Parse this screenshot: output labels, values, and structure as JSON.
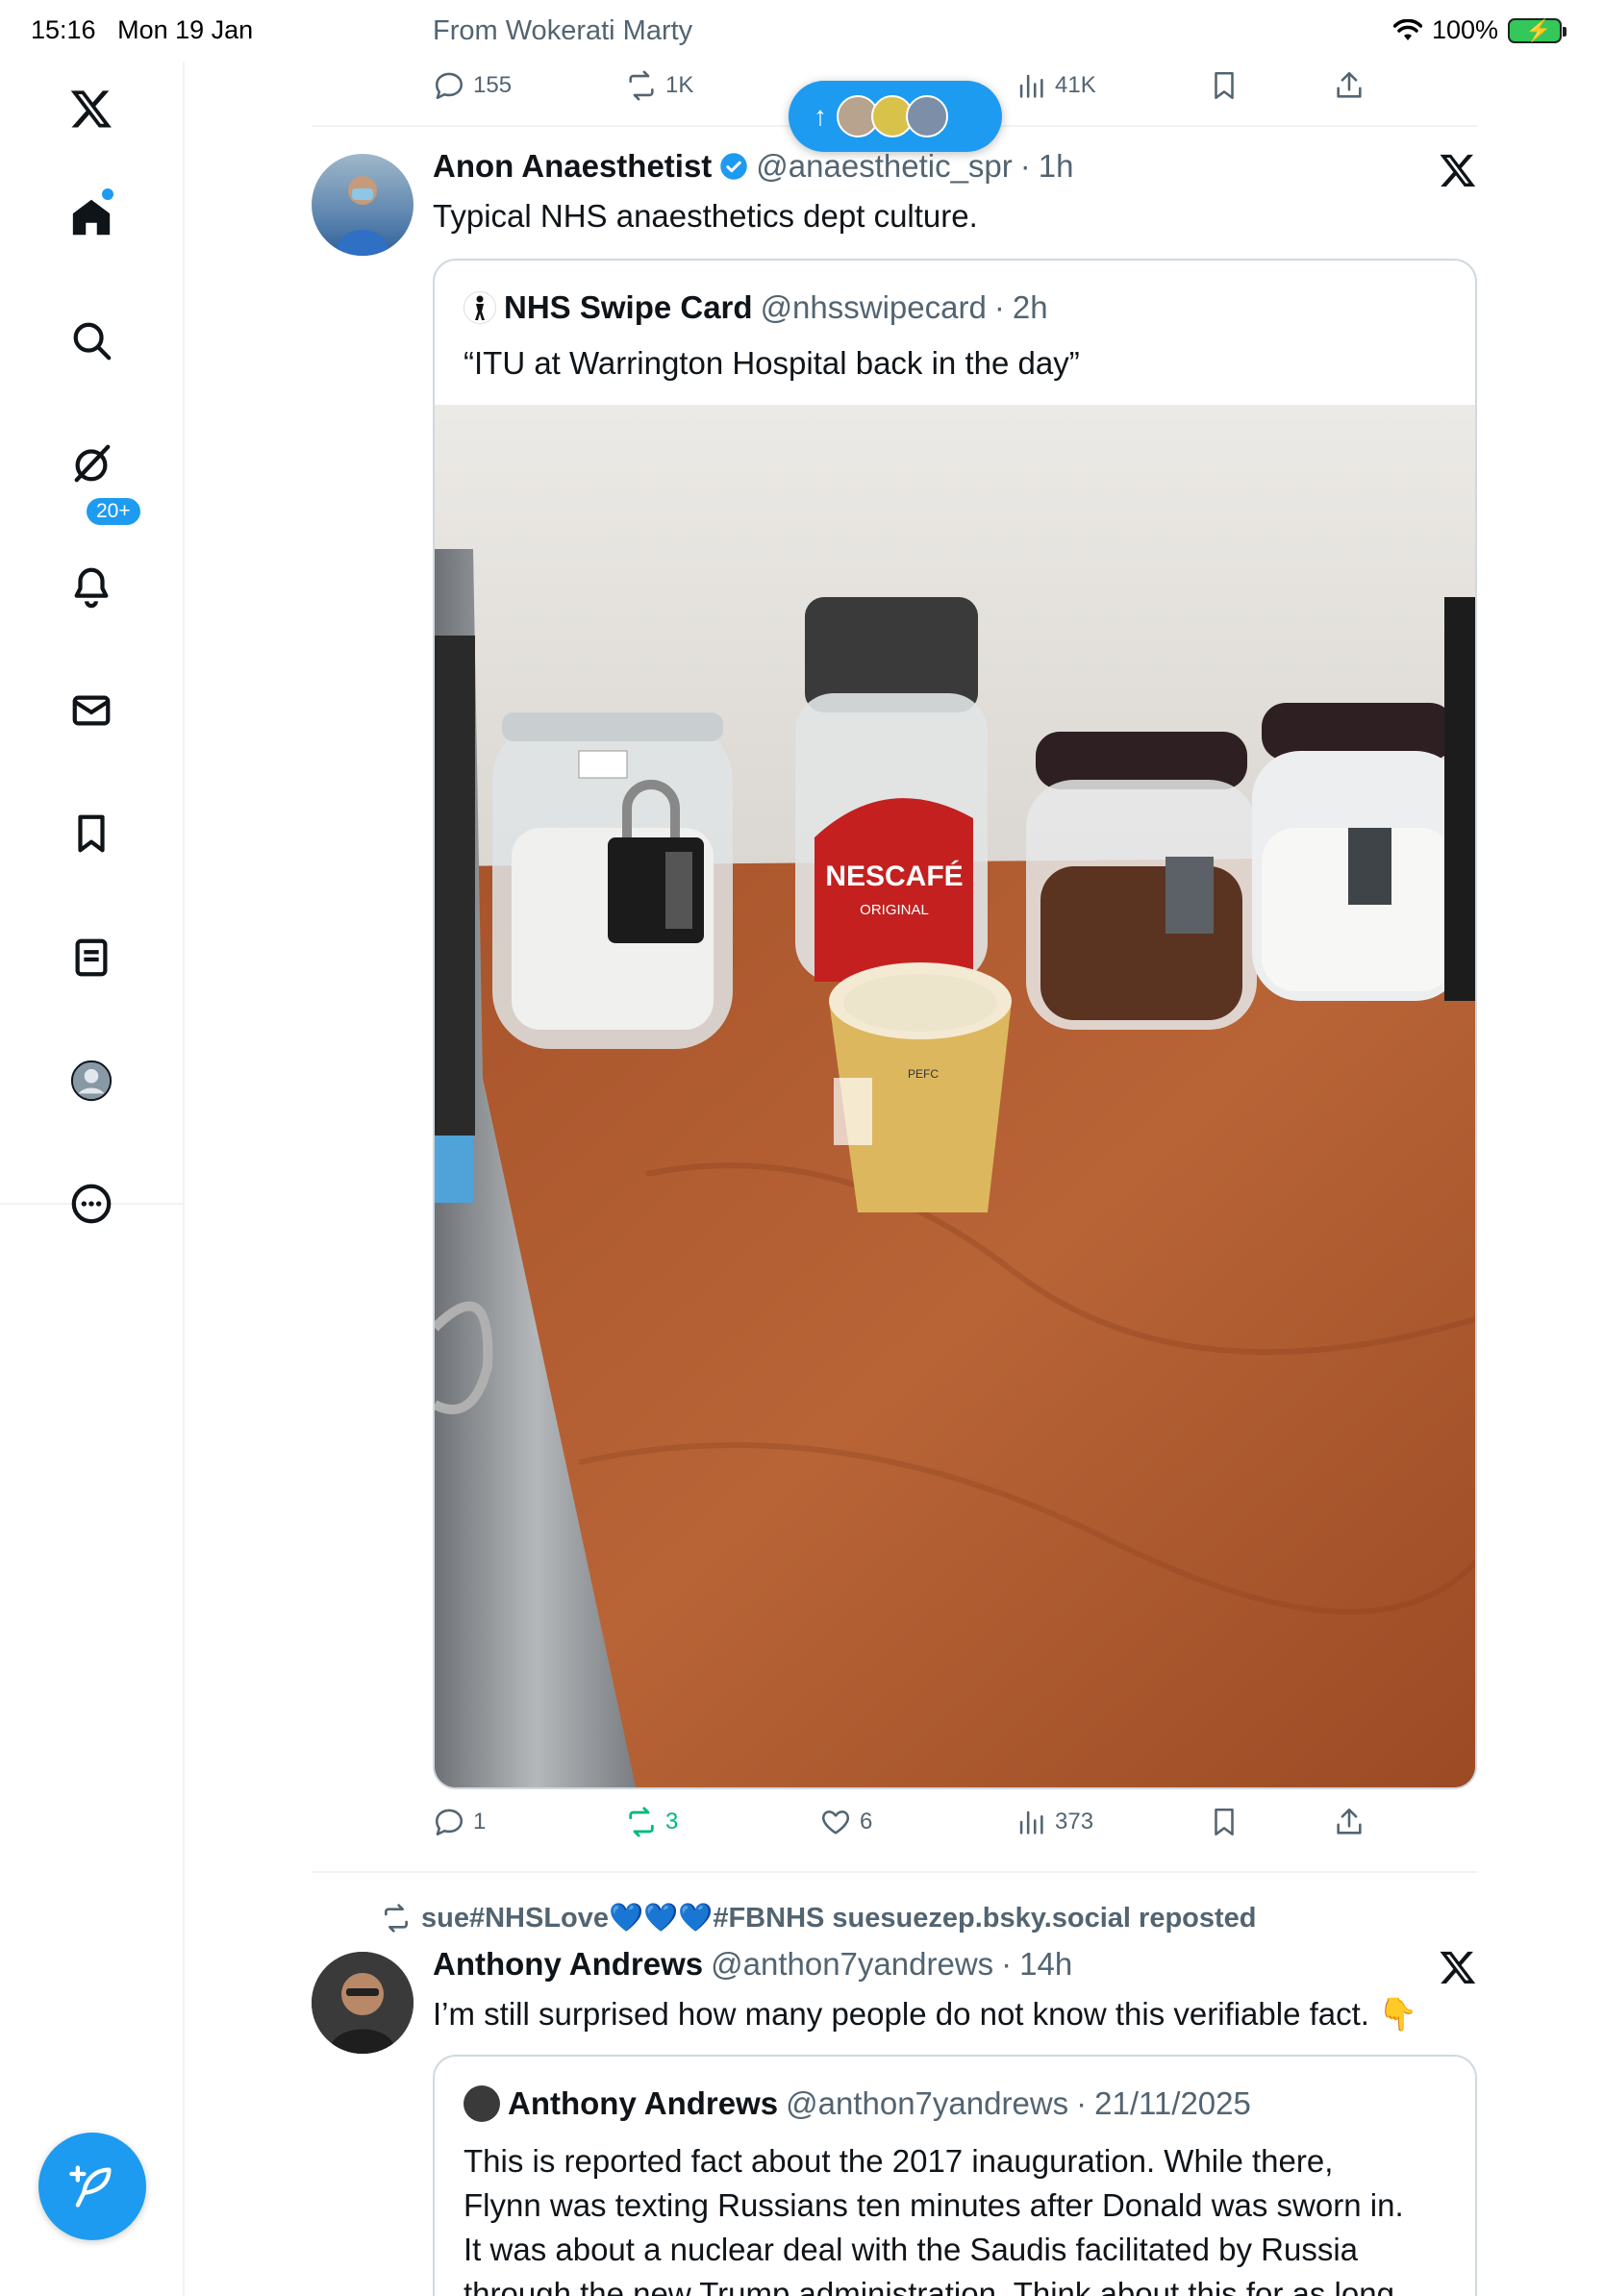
{
  "status_bar": {
    "time": "15:16",
    "date": "Mon 19 Jan",
    "battery": "100%"
  },
  "sidebar": {
    "notifications_badge": "20+",
    "items": [
      {
        "name": "x-logo-icon"
      },
      {
        "name": "home-icon"
      },
      {
        "name": "search-icon"
      },
      {
        "name": "grok-icon"
      },
      {
        "name": "notifications-icon"
      },
      {
        "name": "messages-icon"
      },
      {
        "name": "bookmarks-icon"
      },
      {
        "name": "lists-icon"
      },
      {
        "name": "profile-icon"
      },
      {
        "name": "more-icon"
      }
    ],
    "compose_icon": "feather-plus-icon"
  },
  "previous_tweet": {
    "from_line": "From Wokerati Marty",
    "replies": "155",
    "reposts": "1K",
    "views": "41K"
  },
  "new_posts_pill": {
    "arrow": "↑"
  },
  "tweet1": {
    "name": "Anon Anaesthetist",
    "handle": "@anaesthetic_spr",
    "dot": "·",
    "time": "1h",
    "text": "Typical NHS anaesthetics dept culture.",
    "quote": {
      "name": "NHS Swipe Card",
      "handle": "@nhsswipecard",
      "dot": "·",
      "time": "2h",
      "text": "“ITU at Warrington Hospital back in the day”",
      "image": {
        "jar_label": "NESCAFÉ",
        "jar_sublabel": "ORIGINAL",
        "cup_text": "PEFC"
      }
    },
    "replies": "1",
    "reposts": "3",
    "likes": "6",
    "views": "373"
  },
  "tweet2": {
    "repost_context": "sue#NHSLove💙💙💙#FBNHS suesuezep.bsky.social reposted",
    "name": "Anthony Andrews",
    "handle": "@anthon7yandrews",
    "dot": "·",
    "time": "14h",
    "text": "I’m still surprised how many people do not know this verifiable fact. 👇",
    "quote": {
      "name": "Anthony Andrews",
      "handle": "@anthon7yandrews",
      "dot": "·",
      "time": "21/11/2025",
      "lines": [
        "This is reported fact about the 2017 inauguration. While there,",
        "Flynn was texting Russians ten minutes after Donald was sworn in.",
        "It was about a nuclear deal with the Saudis facilitated by Russia",
        "through the new Trump administration. Think about this for as long"
      ]
    }
  },
  "colors": {
    "accent": "#1d9bf0",
    "text": "#0f1419",
    "secondary": "#536471",
    "repost_green": "#00ba7c",
    "border": "#cfd9de"
  }
}
